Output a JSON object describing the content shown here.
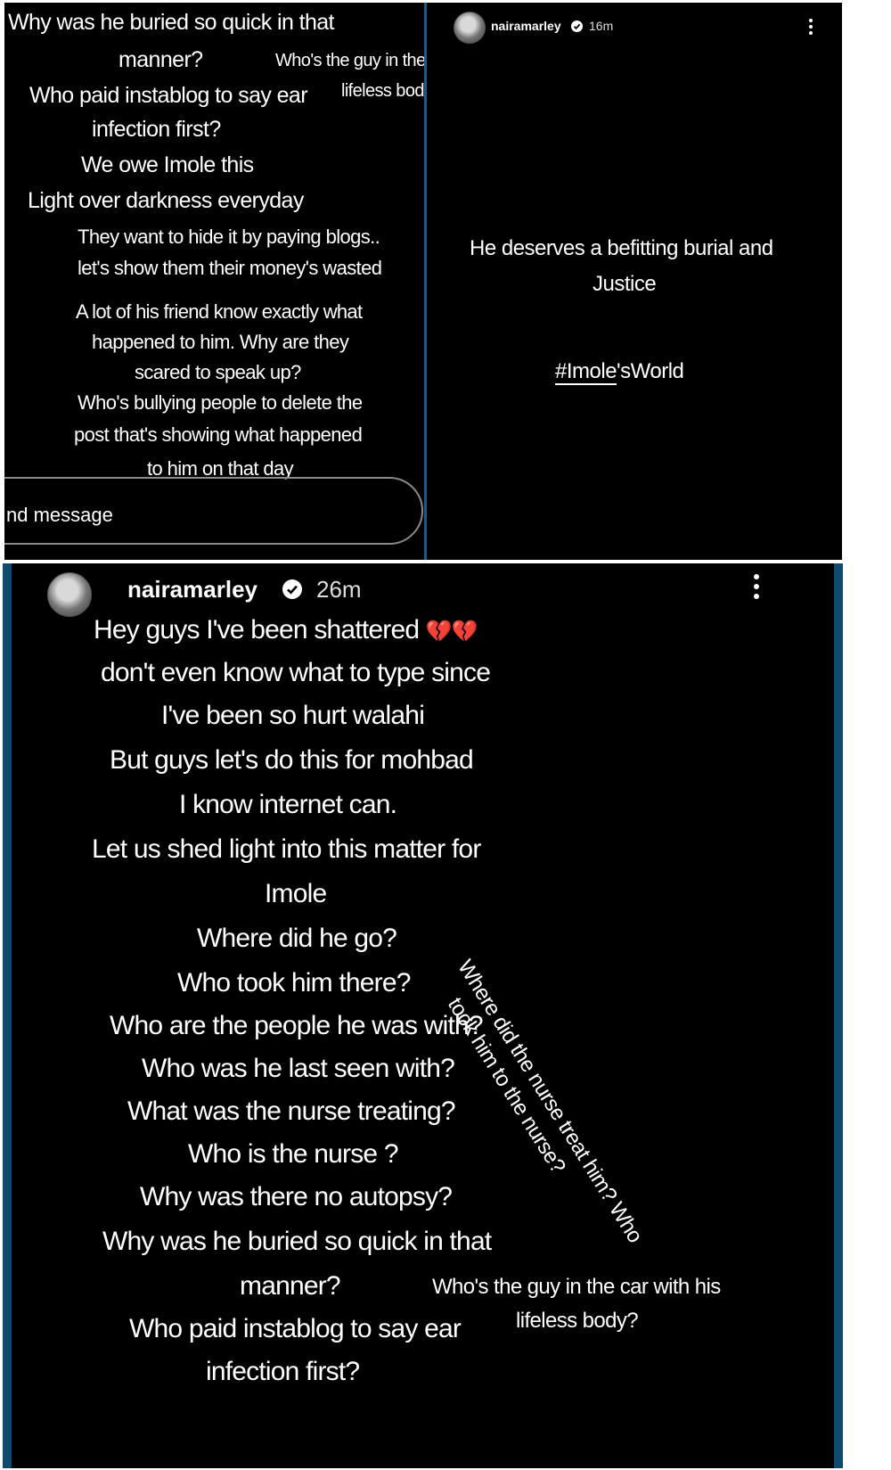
{
  "left_story": {
    "lines": [
      "Why was he buried so quick in that",
      "manner?",
      "Who's the guy in the",
      "Who paid instablog to say ear",
      "lifeless bod",
      "infection first?",
      "We owe Imole this",
      "Light over darkness everyday",
      "They want to hide it by paying blogs..",
      "let's show them their money's wasted",
      "A lot of his friend know exactly what",
      "happened to him. Why are they",
      "scared to speak up?",
      "Who's bullying people to delete the",
      "post that's showing what happened",
      "to him on that day"
    ],
    "message_placeholder": "nd message"
  },
  "right_story": {
    "username": "nairamarley",
    "time": "16m",
    "line1": "He deserves a befitting burial and",
    "line2": "Justice",
    "hashtag_a": "#Imole",
    "hashtag_b": "'sWorld"
  },
  "bottom_story": {
    "username": "nairamarley",
    "time": "26m",
    "first_line": "Hey guys I've been shattered",
    "emoji": "💔💔",
    "lines": [
      "don't even know what to type since",
      "I've been so hurt walahi",
      "But guys let's do this for mohbad",
      "I know internet can.",
      "Let us shed light into this matter for",
      "Imole",
      "Where did he go?",
      "Who took him there?",
      "Who are the people he was with?",
      "Who was he last seen with?",
      "What was the nurse treating?",
      "Who is the nurse ?",
      "Why was there no autopsy?",
      "Why was he buried so quick in that",
      "manner?",
      "Who paid instablog to say ear",
      "infection first?"
    ],
    "side_lines": [
      "Who's the guy in the car with his",
      "lifeless body?"
    ],
    "rotated_lines": [
      "Where did the nurse treat him? Who",
      "took him to the nurse?"
    ]
  },
  "colors": {
    "background": "#000000",
    "divider": "#1a5a8a",
    "border": "#ffffff"
  }
}
